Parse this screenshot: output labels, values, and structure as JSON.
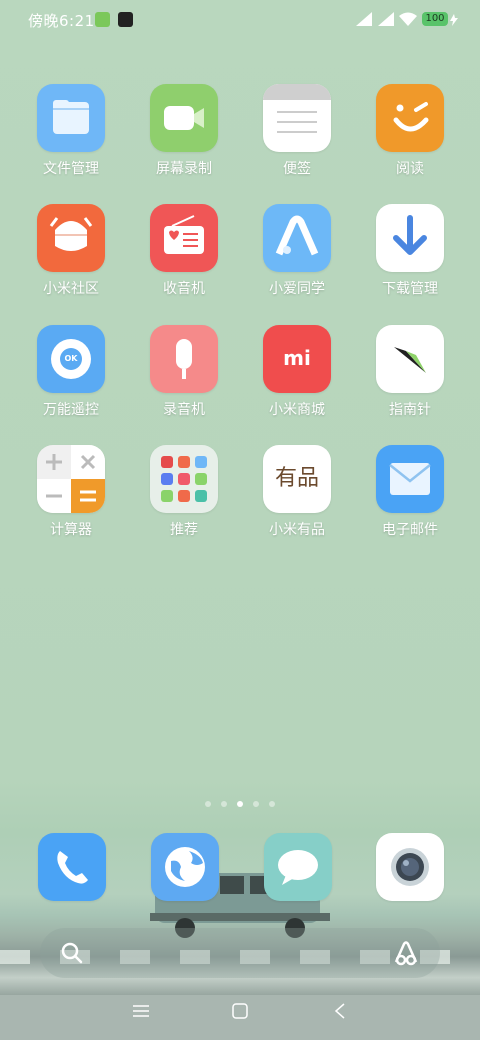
{
  "status_bar": {
    "time": "傍晚6:21",
    "battery": "100"
  },
  "apps": [
    {
      "label": "文件管理",
      "icon": "folder-icon"
    },
    {
      "label": "屏幕录制",
      "icon": "video-camera-icon"
    },
    {
      "label": "便签",
      "icon": "notes-icon"
    },
    {
      "label": "阅读",
      "icon": "reader-smile-icon"
    },
    {
      "label": "小米社区",
      "icon": "mi-community-icon"
    },
    {
      "label": "收音机",
      "icon": "radio-icon"
    },
    {
      "label": "小爱同学",
      "icon": "xiaoai-icon"
    },
    {
      "label": "下载管理",
      "icon": "download-arrow-icon"
    },
    {
      "label": "万能遥控",
      "icon": "remote-control-icon"
    },
    {
      "label": "录音机",
      "icon": "microphone-icon"
    },
    {
      "label": "小米商城",
      "icon": "mi-store-icon"
    },
    {
      "label": "指南针",
      "icon": "compass-icon"
    },
    {
      "label": "计算器",
      "icon": "calculator-icon"
    },
    {
      "label": "推荐",
      "icon": "recommend-folder-icon"
    },
    {
      "label": "小米有品",
      "icon": "youpin-icon"
    },
    {
      "label": "电子邮件",
      "icon": "mail-icon"
    }
  ],
  "youpin_text": "有品",
  "mistore_text": "mi",
  "remote_text": "OK",
  "page_dots": {
    "count": 5,
    "active_index": 2
  },
  "dock": [
    {
      "icon": "phone-icon"
    },
    {
      "icon": "browser-globe-icon"
    },
    {
      "icon": "messages-icon"
    },
    {
      "icon": "camera-icon"
    }
  ],
  "colors": {
    "wallpaper": "#b8d6bd",
    "label": "#ffffff"
  }
}
